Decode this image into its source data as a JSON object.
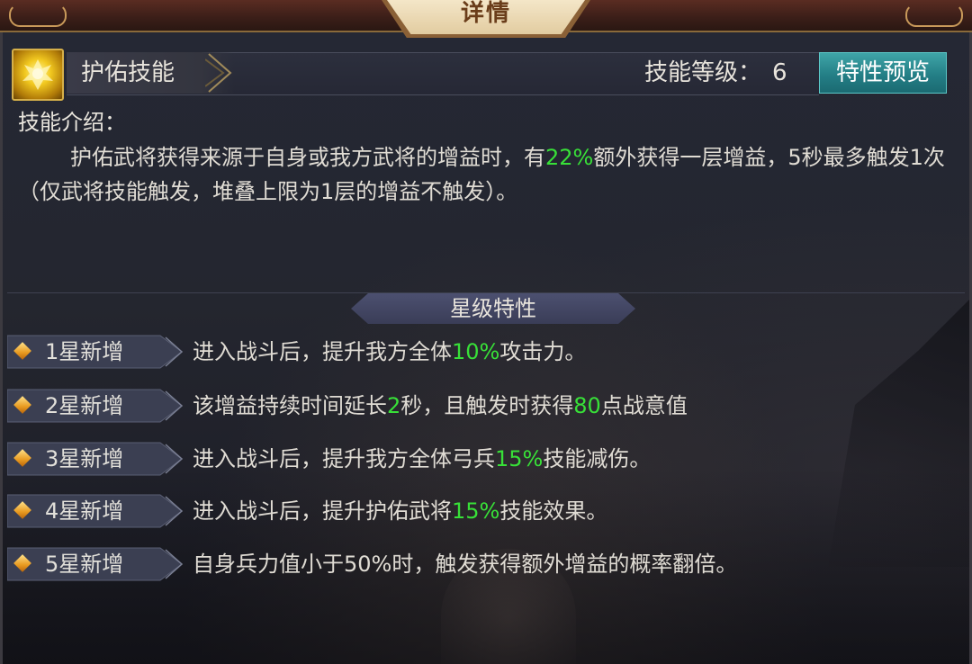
{
  "header": {
    "title": "详情"
  },
  "skill": {
    "name": "护佑技能",
    "level_label": "技能等级：",
    "level_value": "6",
    "preview_button": "特性预览",
    "icon": "golden-spirit-icon"
  },
  "intro": {
    "title": "技能介绍：",
    "parts": [
      "护佑武将获得来源于自身或我方武将的增益时，有",
      "22%",
      "额外获得一层增益，5秒最多触发1次（仅武将技能触发，堆叠上限为1层的增益不触发）。"
    ]
  },
  "stars": {
    "title": "星级特性",
    "rows": [
      {
        "tag": "1星新增",
        "parts": [
          "进入战斗后，提升我方全体",
          "10%",
          "攻击力。"
        ]
      },
      {
        "tag": "2星新增",
        "parts": [
          "该增益持续时间延长",
          "2",
          "秒，且触发时获得",
          "80",
          "点战意值"
        ]
      },
      {
        "tag": "3星新增",
        "parts": [
          "进入战斗后，提升我方全体弓兵",
          "15%",
          "技能减伤。"
        ]
      },
      {
        "tag": "4星新增",
        "parts": [
          "进入战斗后，提升护佑武将",
          "15%",
          "技能效果。"
        ]
      },
      {
        "tag": "5星新增",
        "parts": [
          "自身兵力值小于50%时，触发获得额外增益的概率翻倍。"
        ]
      }
    ]
  },
  "colors": {
    "highlight": "#38e038",
    "button": "#247f86",
    "accent_gold": "#d6b04a"
  }
}
